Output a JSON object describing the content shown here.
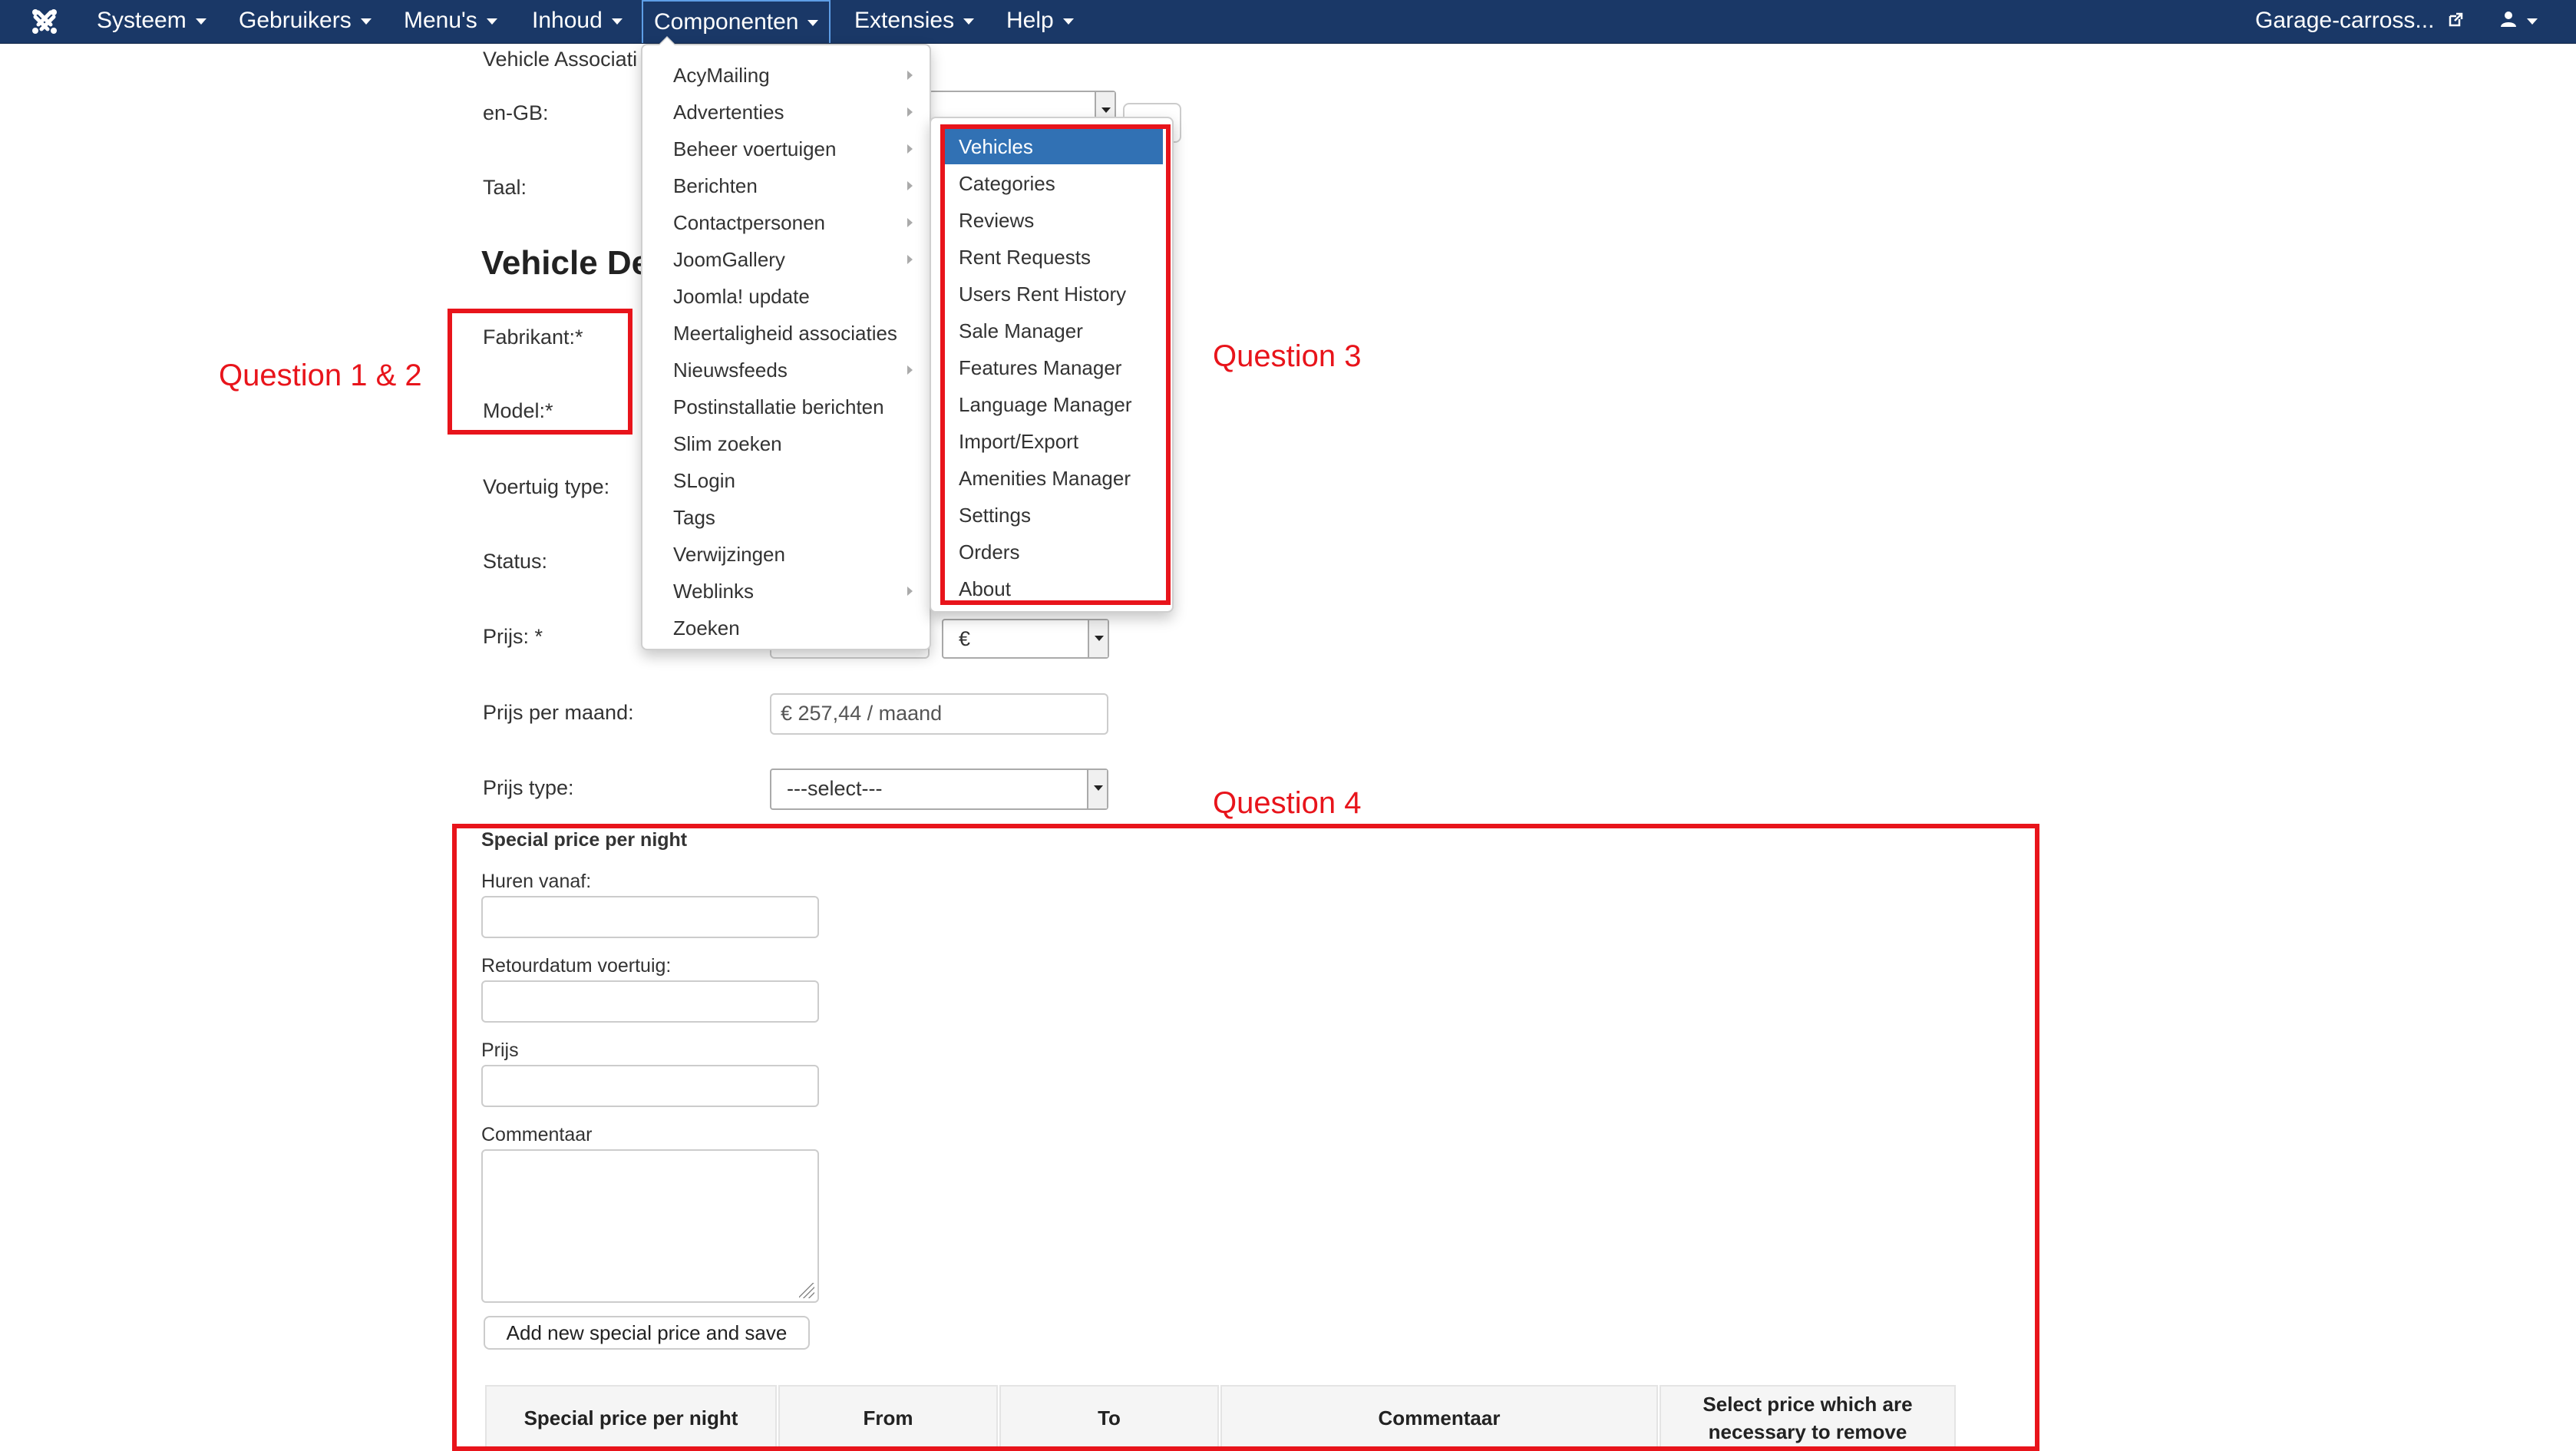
{
  "navbar": {
    "menus": [
      "Systeem",
      "Gebruikers",
      "Menu's",
      "Inhoud",
      "Componenten",
      "Extensies",
      "Help"
    ],
    "site_link": "Garage-carross...",
    "icons": [
      "joomla-logo-icon",
      "external-link-icon",
      "user-icon"
    ]
  },
  "form": {
    "vehicle_associations_label": "Vehicle Associati",
    "en_gb_label": "en-GB:",
    "taal_label": "Taal:",
    "section_title": "Vehicle De",
    "fabrikant_label": "Fabrikant:*",
    "model_label": "Model:*",
    "voertuig_type_label": "Voertuig type:",
    "status_label": "Status:",
    "prijs_label": "Prijs: *",
    "currency_value": "€",
    "prijs_per_maand_label": "Prijs per maand:",
    "prijs_per_maand_value": "€ 257,44 / maand",
    "prijs_type_label": "Prijs type:",
    "prijs_type_value": "---select---"
  },
  "special_price": {
    "heading": "Special price per night",
    "huren_vanaf_label": "Huren vanaf:",
    "retourdatum_label": "Retourdatum voertuig:",
    "prijs_label": "Prijs",
    "commentaar_label": "Commentaar",
    "add_button": "Add new special price and save",
    "table_headers": [
      "Special price per night",
      "From",
      "To",
      "Commentaar",
      "Select price which are necessary to remove"
    ]
  },
  "componenten_menu": {
    "items": [
      {
        "label": "AcyMailing",
        "submenu": true
      },
      {
        "label": "Advertenties",
        "submenu": true
      },
      {
        "label": "Beheer voertuigen",
        "submenu": true
      },
      {
        "label": "Berichten",
        "submenu": true
      },
      {
        "label": "Contactpersonen",
        "submenu": true
      },
      {
        "label": "JoomGallery",
        "submenu": true
      },
      {
        "label": "Joomla! update",
        "submenu": false
      },
      {
        "label": "Meertaligheid associaties",
        "submenu": false
      },
      {
        "label": "Nieuwsfeeds",
        "submenu": true
      },
      {
        "label": "Postinstallatie berichten",
        "submenu": false
      },
      {
        "label": "Slim zoeken",
        "submenu": false
      },
      {
        "label": "SLogin",
        "submenu": false
      },
      {
        "label": "Tags",
        "submenu": false
      },
      {
        "label": "Verwijzingen",
        "submenu": false
      },
      {
        "label": "Weblinks",
        "submenu": true
      },
      {
        "label": "Zoeken",
        "submenu": false
      }
    ]
  },
  "submenu": {
    "items": [
      "Vehicles",
      "Categories",
      "Reviews",
      "Rent Requests",
      "Users Rent History",
      "Sale Manager",
      "Features Manager",
      "Language Manager",
      "Import/Export",
      "Amenities Manager",
      "Settings",
      "Orders",
      "About"
    ],
    "active_index": 0
  },
  "annotations": {
    "q12": "Question 1 & 2",
    "q3": "Question 3",
    "q4": "Question 4"
  },
  "colors": {
    "navbar": "#1a3867",
    "active_item": "#3171b4",
    "annotation_red": "#e8141b"
  }
}
